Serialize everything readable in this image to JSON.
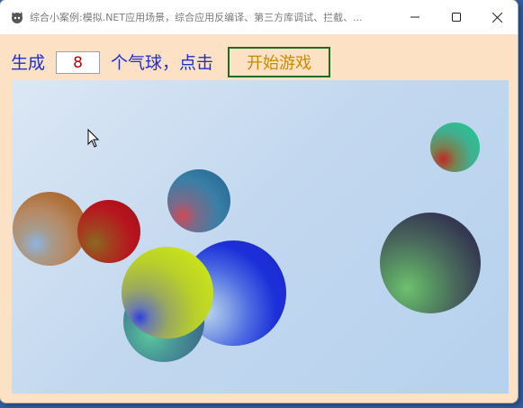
{
  "window": {
    "title": "综合小案例:模拟.NET应用场景，综合应用反编译、第三方库调试、拦截、..."
  },
  "toolbar": {
    "label_generate": "生成",
    "count_value": "8",
    "label_balloons": "个气球，点击",
    "start_button_label": "开始游戏"
  },
  "colors": {
    "window_background": "#fde1c5",
    "label_text": "#1f2fd0",
    "count_text": "#c00000",
    "button_text": "#c88a00",
    "button_border": "#1f6b1f"
  },
  "icons": {
    "app": "app-icon",
    "minimize": "minimize-icon",
    "maximize": "maximize-icon",
    "close": "close-icon",
    "cursor": "mouse-cursor-icon"
  },
  "balloons": [
    {
      "name": "orange-balloon",
      "outer": "#b0703a",
      "inner": "#8fb3e0"
    },
    {
      "name": "red-balloon",
      "outer": "#b8141e",
      "inner": "#8a6a20"
    },
    {
      "name": "teal-blue-balloon",
      "outer": "#2b6f9a",
      "inner": "#d04a56"
    },
    {
      "name": "royal-blue-balloon",
      "outer": "#1c2fd8",
      "inner": "#b9d2ef"
    },
    {
      "name": "steel-teal-balloon",
      "outer": "#3c6a8a",
      "inner": "#5ac89a"
    },
    {
      "name": "lime-balloon",
      "outer": "#c8e21a",
      "inner": "#3040d8"
    },
    {
      "name": "green-balloon",
      "outer": "#2cc090",
      "inner": "#c02828"
    },
    {
      "name": "dark-slate-balloon",
      "outer": "#353a52",
      "inner": "#6ec070"
    }
  ]
}
